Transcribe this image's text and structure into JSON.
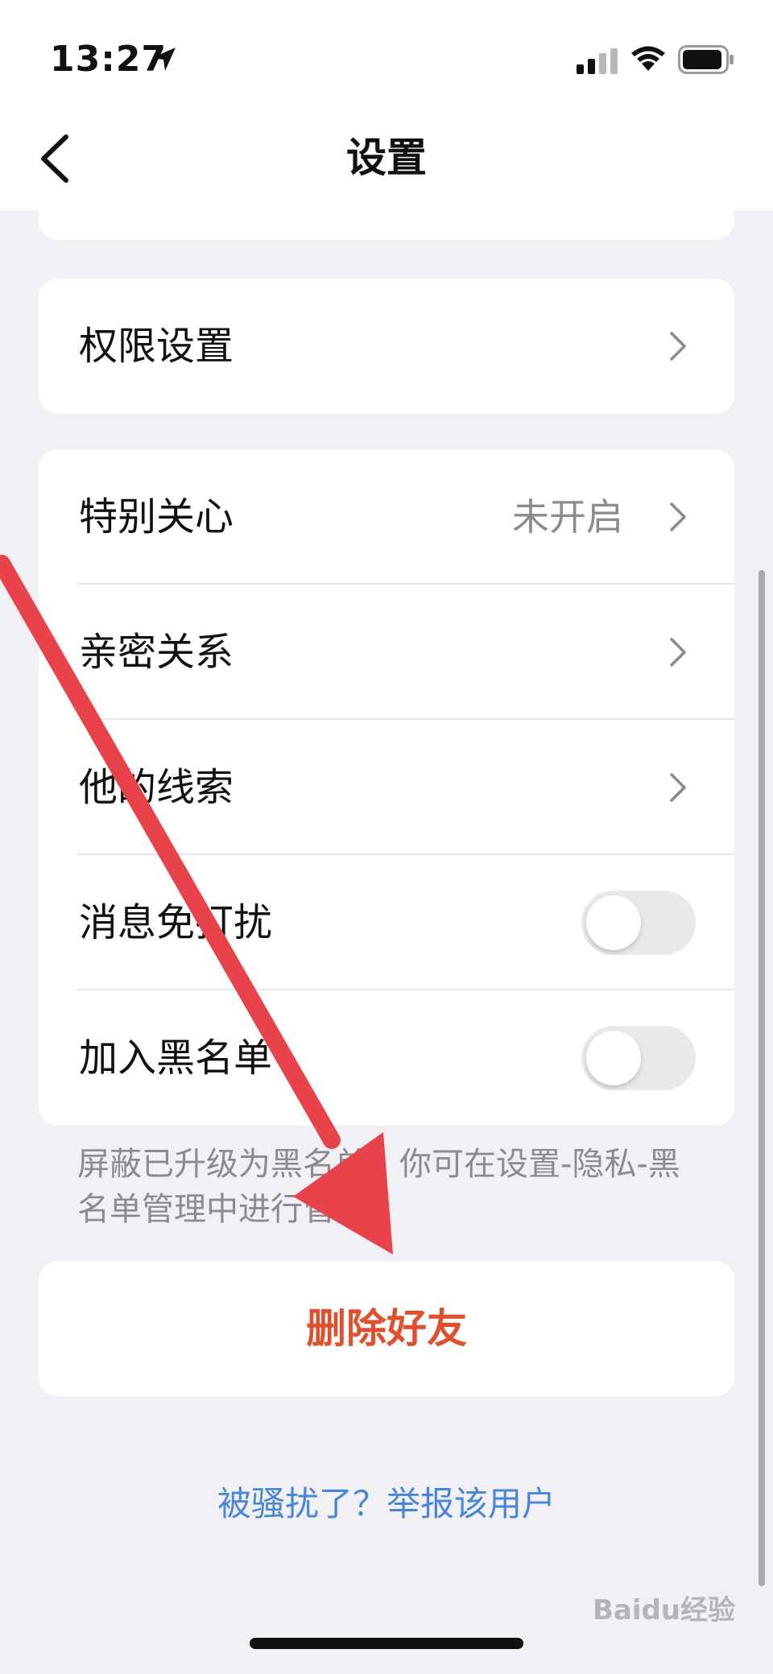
{
  "status_bar": {
    "time": "13:27"
  },
  "nav": {
    "title": "设置"
  },
  "permissions": {
    "label": "权限设置"
  },
  "settings": [
    {
      "label": "特别关心",
      "value": "未开启",
      "kind": "chevron"
    },
    {
      "label": "亲密关系",
      "kind": "chevron"
    },
    {
      "label": "他的线索",
      "kind": "chevron"
    },
    {
      "label": "消息免打扰",
      "kind": "toggle",
      "on": false
    },
    {
      "label": "加入黑名单",
      "kind": "toggle",
      "on": false
    }
  ],
  "note": "屏蔽已升级为黑名单，你可在设置-隐私-黑名单管理中进行管理。",
  "delete_friend": "删除好友",
  "report_link": "被骚扰了？举报该用户",
  "watermark": "Baidu经验",
  "colors": {
    "delete": "#e0502e",
    "link": "#4a86d8",
    "annotation_arrow": "#e8434b"
  }
}
